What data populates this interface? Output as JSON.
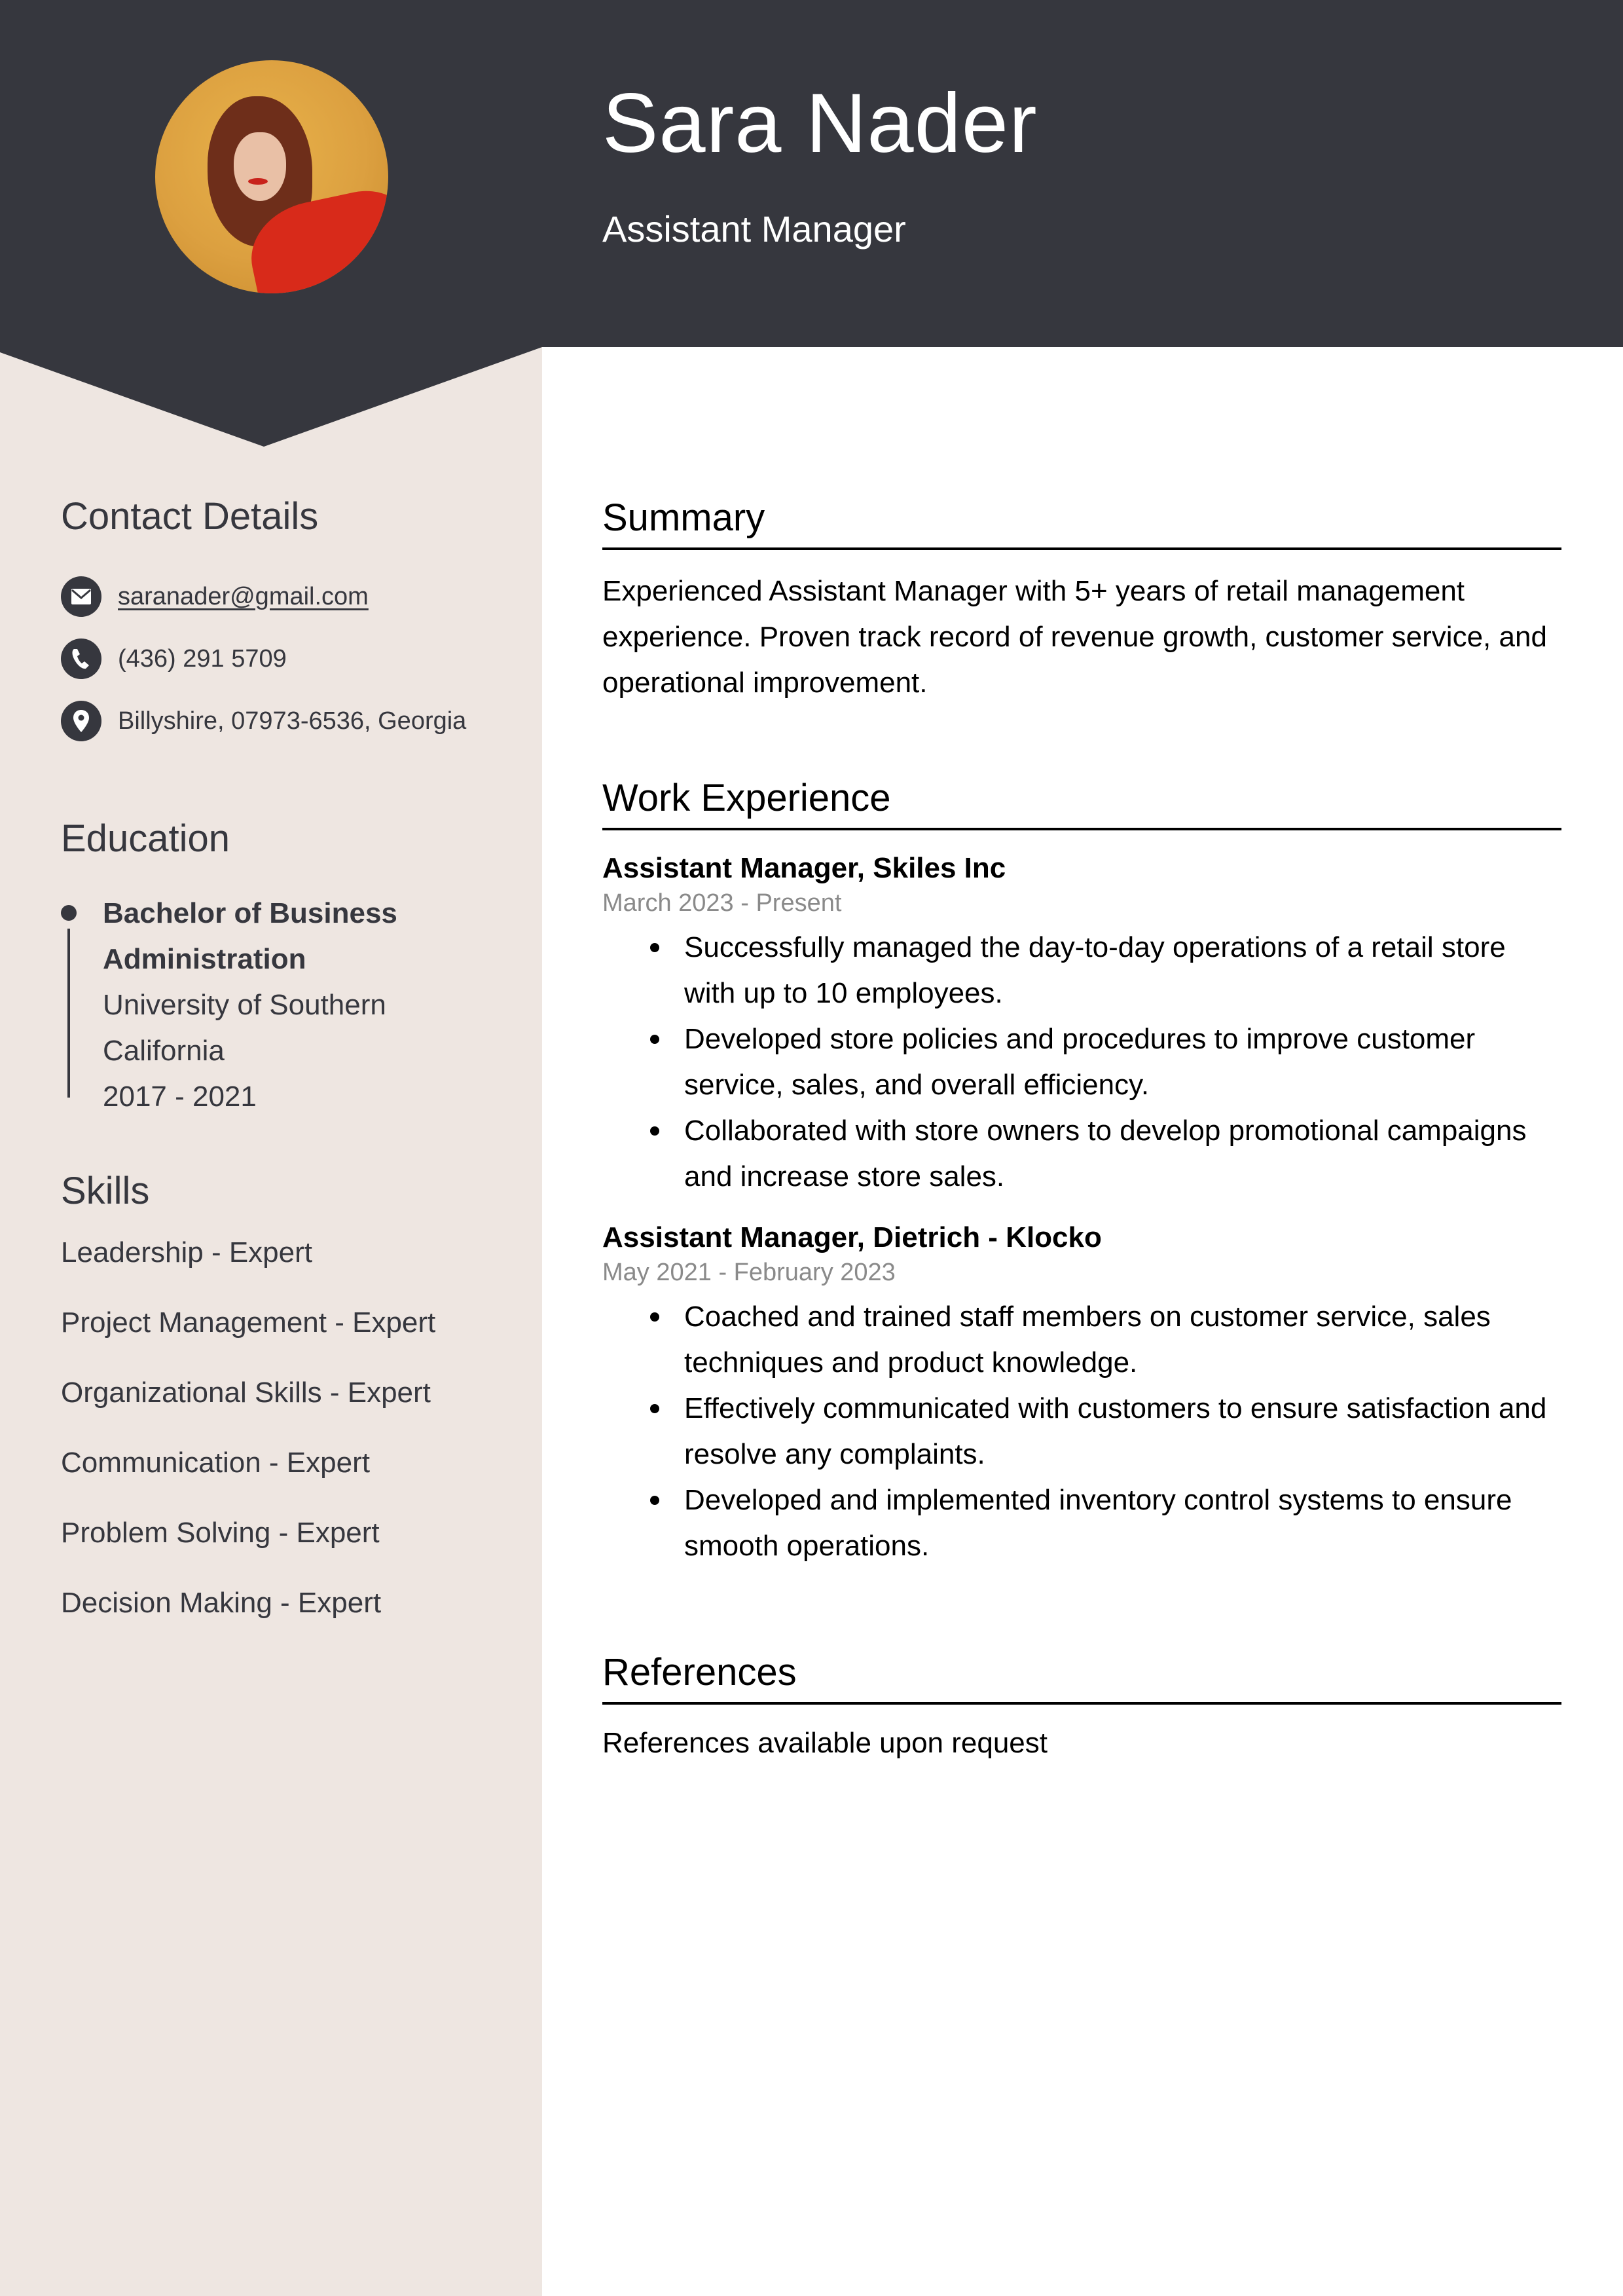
{
  "header": {
    "name": "Sara Nader",
    "title": "Assistant Manager",
    "photo": "profile-photo"
  },
  "colors": {
    "header_bg": "#36373e",
    "sidebar_bg": "#eee6e1",
    "text_dark": "#36373e",
    "date_gray": "#8a8a8a"
  },
  "contact": {
    "heading": "Contact Details",
    "items": [
      {
        "icon": "email-icon",
        "text": "saranader@gmail.com"
      },
      {
        "icon": "phone-icon",
        "text": "(436) 291 5709"
      },
      {
        "icon": "location-pin-icon",
        "text": "Billyshire, 07973-6536, Georgia"
      }
    ]
  },
  "education": {
    "heading": "Education",
    "items": [
      {
        "degree_line1": "Bachelor of Business",
        "degree_line2": "Administration",
        "school_line1": "University of Southern",
        "school_line2": "California",
        "years": "2017 - 2021"
      }
    ]
  },
  "skills": {
    "heading": "Skills",
    "items": [
      "Leadership - Expert",
      "Project Management - Expert",
      "Organizational Skills - Expert",
      "Communication - Expert",
      "Problem Solving - Expert",
      "Decision Making - Expert"
    ]
  },
  "summary": {
    "heading": "Summary",
    "text": "Experienced Assistant Manager with 5+ years of retail management experience. Proven track record of revenue growth, customer service, and operational improvement."
  },
  "work": {
    "heading": "Work Experience",
    "jobs": [
      {
        "title": "Assistant Manager, Skiles Inc",
        "dates": "March 2023 - Present",
        "bullets": [
          "Successfully managed the day-to-day operations of a retail store with up to 10 employees.",
          "Developed store policies and procedures to improve customer service, sales, and overall efficiency.",
          "Collaborated with store owners to develop promotional campaigns and increase store sales."
        ]
      },
      {
        "title": "Assistant Manager, Dietrich - Klocko",
        "dates": "May 2021 - February 2023",
        "bullets": [
          "Coached and trained staff members on customer service, sales techniques and product knowledge.",
          "Effectively communicated with customers to ensure satisfaction and resolve any complaints.",
          "Developed and implemented inventory control systems to ensure smooth operations."
        ]
      }
    ]
  },
  "references": {
    "heading": "References",
    "text": "References available upon request"
  }
}
